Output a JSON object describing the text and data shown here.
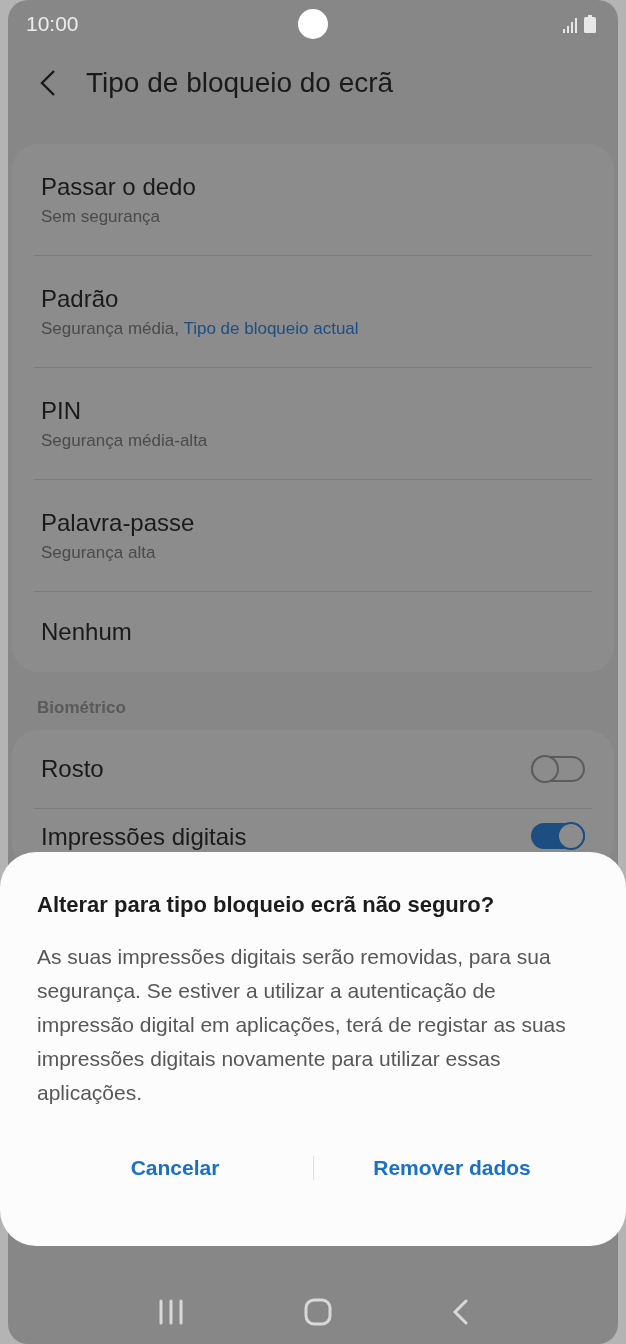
{
  "status_bar": {
    "time": "10:00"
  },
  "header": {
    "title": "Tipo de bloqueio do ecrã"
  },
  "lock_types": [
    {
      "title": "Passar o dedo",
      "subtitle": "Sem segurança"
    },
    {
      "title": "Padrão",
      "subtitle": "Segurança média,",
      "current_label": "Tipo de bloqueio actual"
    },
    {
      "title": "PIN",
      "subtitle": "Segurança média-alta"
    },
    {
      "title": "Palavra-passe",
      "subtitle": "Segurança alta"
    },
    {
      "title": "Nenhum"
    }
  ],
  "biometrics": {
    "heading": "Biométrico",
    "items": [
      {
        "kind": "toggle",
        "title": "Rosto",
        "on": false
      },
      {
        "kind": "toggle",
        "title": "Impressões digitais",
        "on": true
      }
    ]
  },
  "dialog": {
    "title": "Alterar para tipo bloqueio ecrã não seguro?",
    "message": "As suas impressões digitais serão removidas, para sua segurança. Se estiver a utilizar a autenticação de impressão digital em aplicações, terá de registar as suas impressões digitais novamente para utilizar essas aplicações.",
    "buttons": [
      "Cancelar",
      "Remover dados"
    ]
  }
}
